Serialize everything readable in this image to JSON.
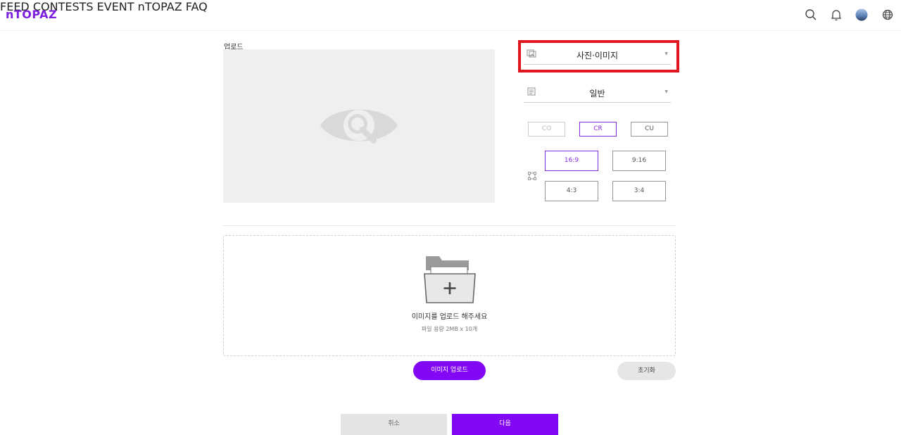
{
  "header": {
    "logo": "nTOPAZ",
    "nav": [
      "FEED",
      "CONTESTS",
      "EVENT",
      "nTOPAZ",
      "FAQ"
    ],
    "icons": [
      "search-icon",
      "bell-icon",
      "avatar",
      "globe-icon"
    ]
  },
  "upload": {
    "label": "업로드"
  },
  "form": {
    "media_type": {
      "icon": "image-icon",
      "value": "사진·이미지"
    },
    "category": {
      "icon": "category-icon",
      "value": "일반"
    },
    "licenses": [
      {
        "label": "CO",
        "state": "disabled"
      },
      {
        "label": "CR",
        "state": "selected"
      },
      {
        "label": "CU",
        "state": "normal"
      }
    ],
    "ratios": [
      {
        "label": "16:9",
        "state": "selected"
      },
      {
        "label": "9:16",
        "state": "normal"
      },
      {
        "label": "4:3",
        "state": "normal"
      },
      {
        "label": "3:4",
        "state": "normal"
      }
    ]
  },
  "dropzone": {
    "title": "이미지를 업로드 해주세요",
    "subtitle": "파일 용량 2MB x 10개"
  },
  "buttons": {
    "upload": "이미지 업로드",
    "reset": "초기화",
    "cancel": "취소",
    "next": "다음"
  },
  "colors": {
    "accent": "#8208f5",
    "highlight": "#e0161e",
    "logo": "#7d1fe0"
  }
}
